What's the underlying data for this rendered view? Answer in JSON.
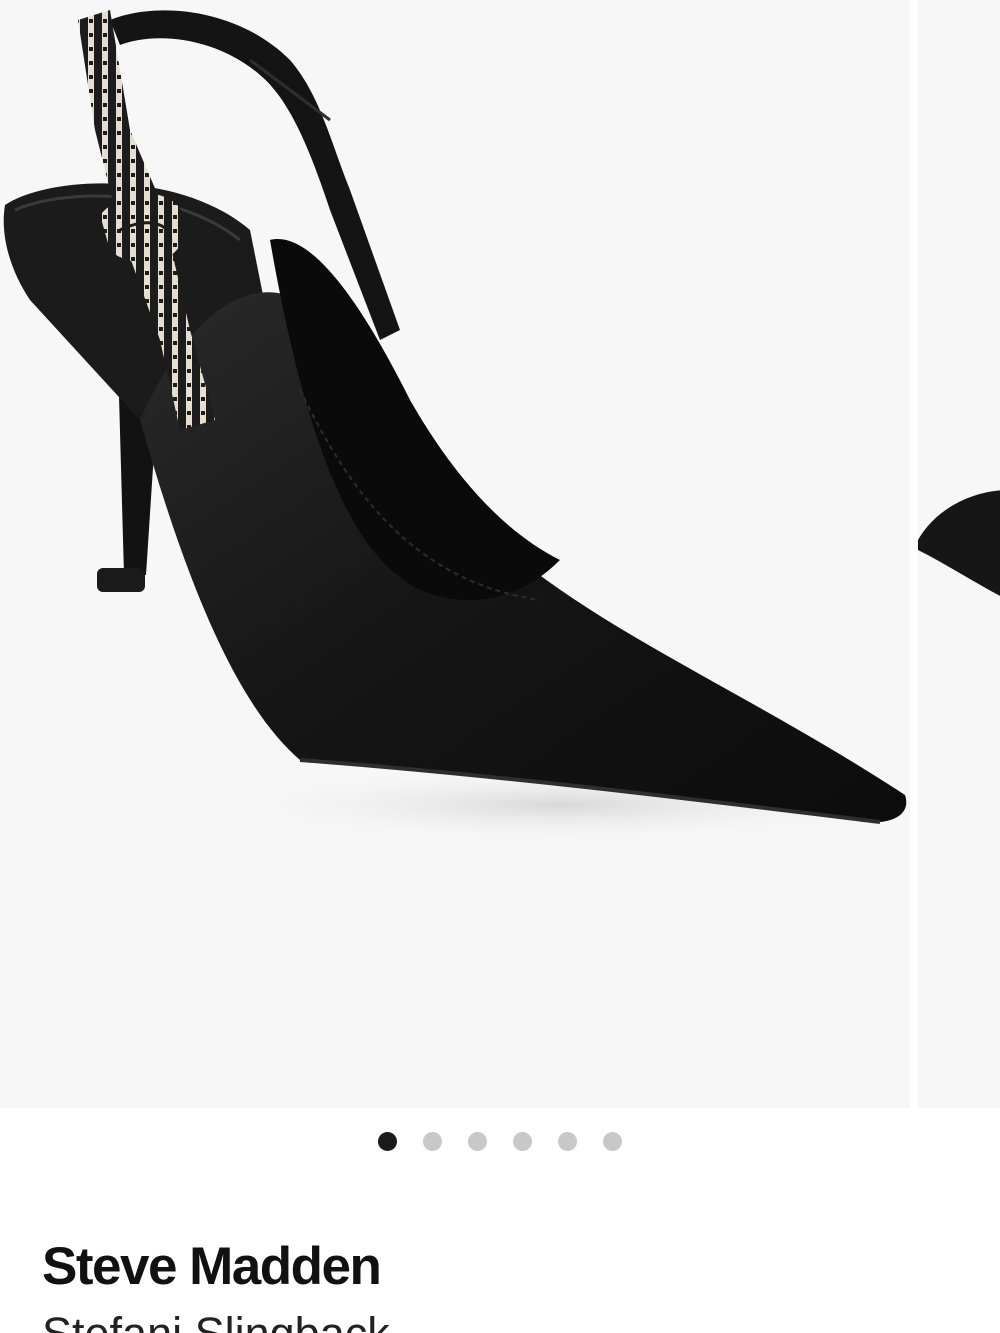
{
  "product": {
    "brand": "Steve Madden",
    "name": "Stefani Slingback"
  },
  "gallery": {
    "image_count": 6,
    "active_index": 0,
    "main_image": {
      "subject": "black pointed-toe slingback pump with striped knotted strap",
      "colors": {
        "shoe": "#161616",
        "strap_light": "#e6ded0",
        "background": "#f7f7f7"
      }
    },
    "dots": [
      {
        "state": "active"
      },
      {
        "state": "inactive"
      },
      {
        "state": "inactive"
      },
      {
        "state": "inactive"
      },
      {
        "state": "inactive"
      },
      {
        "state": "inactive"
      }
    ]
  },
  "colors": {
    "text_primary": "#111111",
    "dot_active": "#1a1a1a",
    "dot_inactive": "#c8c8c8"
  }
}
